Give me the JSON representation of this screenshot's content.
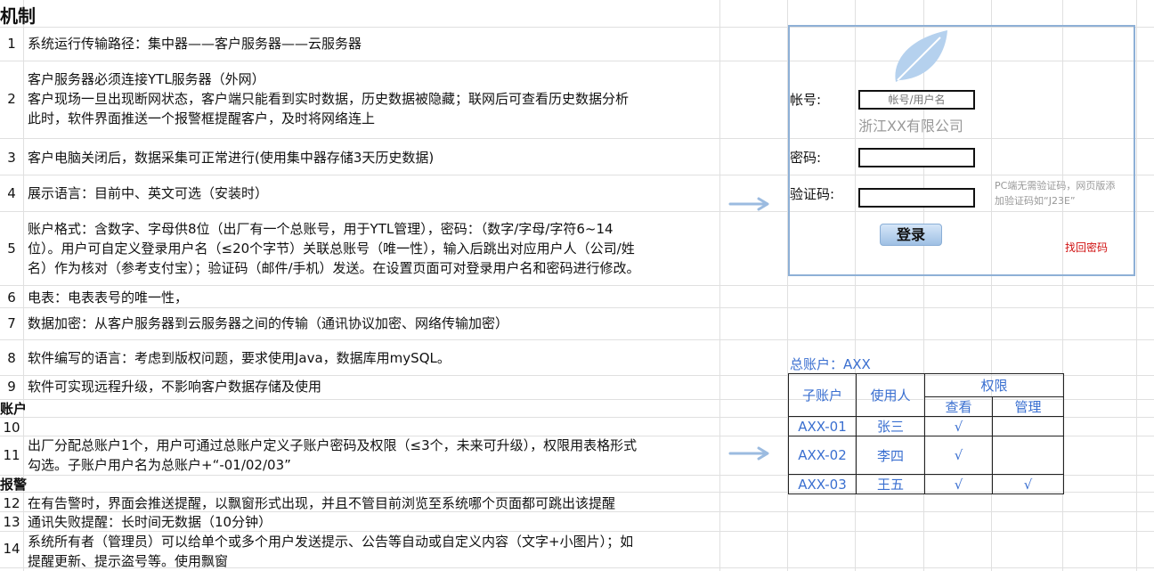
{
  "sheet": {
    "title": "机制",
    "sections": {
      "account": "账户",
      "alarm": "报警"
    },
    "rows": [
      {
        "num": "1",
        "text": "系统运行传输路径：集中器——客户服务器——云服务器"
      },
      {
        "num": "2",
        "text": "客户服务器必须连接YTL服务器（外网）\n客户现场一旦出现断网状态，客户端只能看到实时数据，历史数据被隐藏；联网后可查看历史数据分析\n此时，软件界面推送一个报警框提醒客户，及时将网络连上"
      },
      {
        "num": "3",
        "text": "客户电脑关闭后，数据采集可正常进行(使用集中器存储3天历史数据)"
      },
      {
        "num": "4",
        "text": "展示语言：目前中、英文可选（安装时）"
      },
      {
        "num": "5",
        "text": "账户格式：含数字、字母供8位（出厂有一个总账号，用于YTL管理），密码：（数字/字母/字符6~14\n位）。用户可自定义登录用户名（≤20个字节）关联总账号（唯一性），输入后跳出对应用户人（公司/姓\n名）作为核对（参考支付宝）；验证码（邮件/手机）发送。在设置页面可对登录用户名和密码进行修改。"
      },
      {
        "num": "6",
        "text": "电表：电表表号的唯一性，"
      },
      {
        "num": "7",
        "text": "数据加密：从客户服务器到云服务器之间的传输（通讯协议加密、网络传输加密）"
      },
      {
        "num": "8",
        "text": "软件编写的语言：考虑到版权问题，要求使用Java，数据库用mySQL。"
      },
      {
        "num": "9",
        "text": "软件可实现远程升级，不影响客户数据存储及使用"
      },
      {
        "num": "10",
        "text": ""
      },
      {
        "num": "11",
        "text": "出厂分配总账户1个，用户可通过总账户定义子账户密码及权限（≤3个，未来可升级），权限用表格形式\n勾选。子账户用户名为总账户+“-01/02/03”"
      },
      {
        "num": "12",
        "text": "在有告警时，界面会推送提醒，以飘窗形式出现，并且不管目前浏览至系统哪个页面都可跳出该提醒"
      },
      {
        "num": "13",
        "text": "通讯失败提醒：长时间无数据（10分钟）"
      },
      {
        "num": "14",
        "text": "系统所有者（管理员）可以给单个或多个用户发送提示、公告等自动或自定义内容（文字+小图片）；如\n提醒更新、提示盗号等。使用飘窗"
      }
    ]
  },
  "login": {
    "company": "浙江XX有限公司",
    "account_label": "帐号:",
    "account_placeholder": "帐号/用户名",
    "password_label": "密码:",
    "captcha_label": "验证码:",
    "captcha_note": "PC端无需验证码，网页版添\n加验证码如“J23E”",
    "login_button": "登录",
    "forgot_link": "找回密码"
  },
  "permissions": {
    "master_label": "总账户：AXX",
    "headers": {
      "sub_account": "子账户",
      "user": "使用人",
      "rights": "权限",
      "view": "查看",
      "manage": "管理"
    },
    "rows": [
      {
        "sub": "AXX-01",
        "user": "张三",
        "view": "√",
        "manage": ""
      },
      {
        "sub": "AXX-02",
        "user": "李四",
        "view": "√",
        "manage": ""
      },
      {
        "sub": "AXX-03",
        "user": "王五",
        "view": "√",
        "manage": "√"
      }
    ]
  },
  "colors": {
    "accent_blue": "#3a6fd0",
    "link_red": "#d01010",
    "frame_blue": "#8eb0d6",
    "grid": "#e0e0e0"
  }
}
